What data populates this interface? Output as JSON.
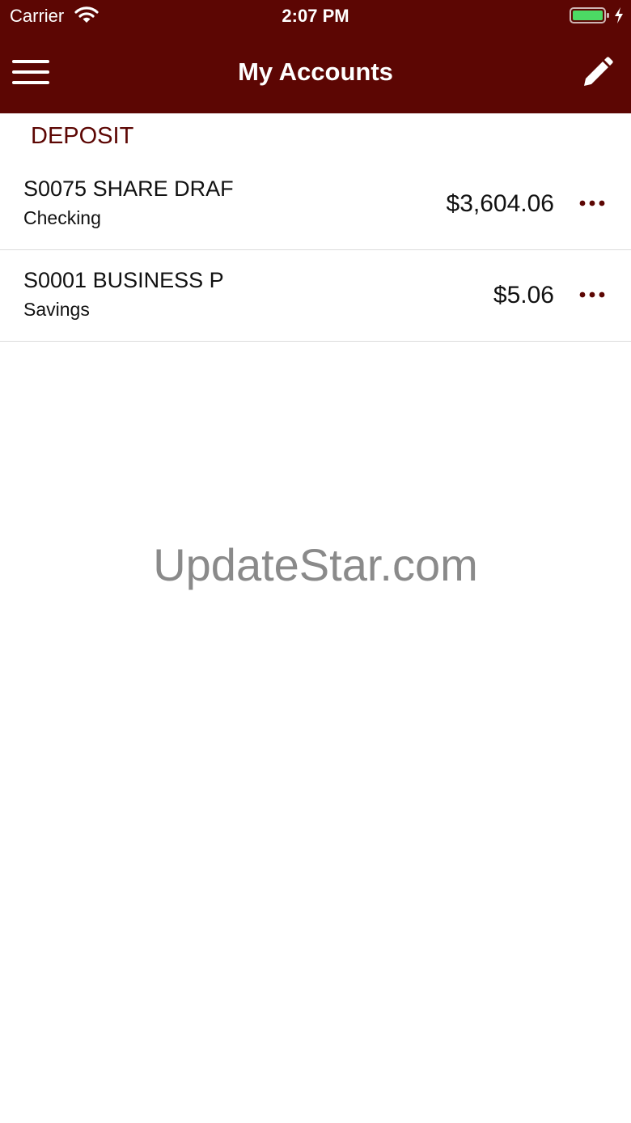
{
  "status_bar": {
    "carrier": "Carrier",
    "time": "2:07 PM"
  },
  "nav": {
    "title": "My Accounts",
    "menu_icon": "hamburger-menu-icon",
    "edit_icon": "pencil-icon"
  },
  "sections": [
    {
      "header": "DEPOSIT",
      "accounts": [
        {
          "name": "S0075 SHARE DRAF",
          "type": "Checking",
          "balance": "$3,604.06"
        },
        {
          "name": "S0001 BUSINESS P",
          "type": "Savings",
          "balance": "$5.06"
        }
      ]
    }
  ],
  "watermark": "UpdateStar.com",
  "colors": {
    "brand": "#5c0603",
    "battery": "#4cd964",
    "divider": "#dcdcdc",
    "watermark": "#8a8a8a"
  }
}
